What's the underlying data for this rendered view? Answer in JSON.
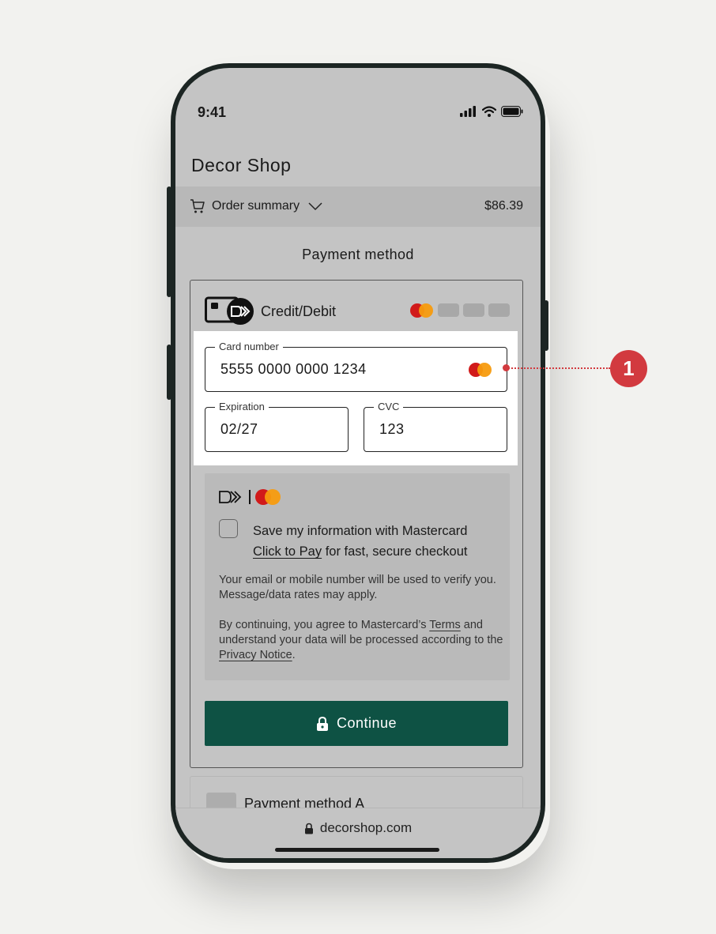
{
  "status_bar": {
    "time": "9:41"
  },
  "header": {
    "title": "Decor Shop"
  },
  "order_summary": {
    "label": "Order summary",
    "total": "$86.39"
  },
  "payment": {
    "heading": "Payment method",
    "credit_debit": {
      "label": "Credit/Debit",
      "card_number": {
        "legend": "Card number",
        "value": "5555 0000 0000 1234"
      },
      "expiration": {
        "legend": "Expiration",
        "value": "02/27"
      },
      "cvc": {
        "legend": "CVC",
        "value": "123"
      }
    },
    "click_to_pay": {
      "save_line1": "Save my information with Mastercard",
      "save_link": "Click to Pay",
      "save_line2": "for fast, secure checkout",
      "notice1": "Your email or mobile number will be used to verify you. Message/data rates may apply.",
      "consent_prefix": "By continuing, you agree to Mastercard’s",
      "terms_link": "Terms",
      "consent_middle": "and understand your data will be processed according to the",
      "privacy_link": "Privacy Notice",
      "consent_suffix": "."
    },
    "continue_label": "Continue",
    "method_a_label": "Payment method A"
  },
  "browser": {
    "url": "decorshop.com"
  },
  "callout": {
    "number": "1"
  },
  "colors": {
    "accent": "#0e5244",
    "callout": "#d23a3f",
    "mc_red": "#d11a1a",
    "mc_orange": "#f79b0e"
  }
}
